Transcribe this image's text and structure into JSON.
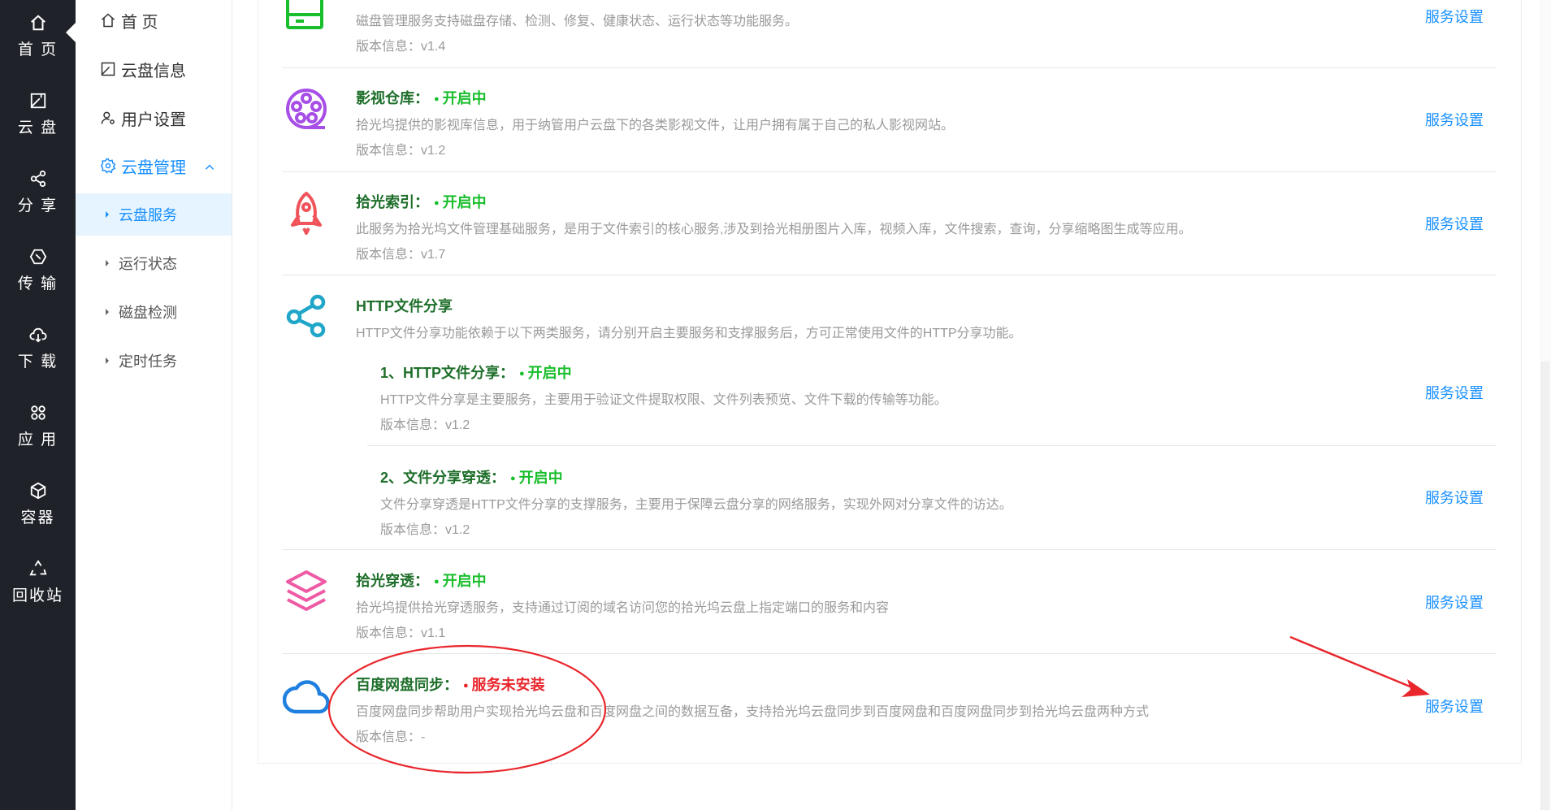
{
  "rail": {
    "items": [
      {
        "label": "首 页",
        "icon": "home-icon"
      },
      {
        "label": "云 盘",
        "icon": "disk-icon"
      },
      {
        "label": "分 享",
        "icon": "share-icon"
      },
      {
        "label": "传 输",
        "icon": "transfer-icon"
      },
      {
        "label": "下 载",
        "icon": "download-icon"
      },
      {
        "label": "应 用",
        "icon": "apps-icon"
      },
      {
        "label": "容器",
        "icon": "container-icon"
      },
      {
        "label": "回收站",
        "icon": "recycle-icon"
      }
    ]
  },
  "subnav": {
    "items": [
      {
        "label": "首 页",
        "icon": "home-icon"
      },
      {
        "label": "云盘信息",
        "icon": "disk-icon"
      },
      {
        "label": "用户设置",
        "icon": "user-settings-icon"
      },
      {
        "label": "云盘管理",
        "icon": "gear-icon"
      }
    ],
    "sub_items": [
      {
        "label": "云盘服务"
      },
      {
        "label": "运行状态"
      },
      {
        "label": "磁盘检测"
      },
      {
        "label": "定时任务"
      }
    ]
  },
  "services": [
    {
      "title": "",
      "status": "",
      "desc": "磁盘管理服务支持磁盘存储、检测、修复、健康状态、运行状态等功能服务。",
      "version": "版本信息：v1.4",
      "link": "服务设置",
      "icon": "disk-manager-icon"
    },
    {
      "title": "影视仓库：",
      "status": "开启中",
      "desc": "拾光坞提供的影视库信息，用于纳管用户云盘下的各类影视文件，让用户拥有属于自己的私人影视网站。",
      "version": "版本信息：v1.2",
      "link": "服务设置",
      "icon": "film-reel-icon"
    },
    {
      "title": "拾光索引：",
      "status": "开启中",
      "desc": "此服务为拾光坞文件管理基础服务，是用于文件索引的核心服务,涉及到拾光相册图片入库，视频入库，文件搜索，查询，分享缩略图生成等应用。",
      "version": "版本信息：v1.7",
      "link": "服务设置",
      "icon": "rocket-icon"
    },
    {
      "title": "HTTP文件分享",
      "desc": "HTTP文件分享功能依赖于以下两类服务，请分别开启主要服务和支撑服务后，方可正常使用文件的HTTP分享功能。",
      "icon": "share-nodes-icon",
      "children": [
        {
          "title": "1、HTTP文件分享：",
          "status": "开启中",
          "desc": "HTTP文件分享是主要服务，主要用于验证文件提取权限、文件列表预览、文件下载的传输等功能。",
          "version": "版本信息：v1.2",
          "link": "服务设置"
        },
        {
          "title": "2、文件分享穿透：",
          "status": "开启中",
          "desc": "文件分享穿透是HTTP文件分享的支撑服务，主要用于保障云盘分享的网络服务，实现外网对分享文件的访达。",
          "version": "版本信息：v1.2",
          "link": "服务设置"
        }
      ]
    },
    {
      "title": "拾光穿透：",
      "status": "开启中",
      "desc": "拾光坞提供拾光穿透服务，支持通过订阅的域名访问您的拾光坞云盘上指定端口的服务和内容",
      "version": "版本信息：v1.1",
      "link": "服务设置",
      "icon": "layers-icon"
    },
    {
      "title": "百度网盘同步：",
      "status": "服务未安装",
      "desc": "百度网盘同步帮助用户实现拾光坞云盘和百度网盘之间的数据互备，支持拾光坞云盘同步到百度网盘和百度网盘同步到拾光坞云盘两种方式",
      "version": "版本信息：-",
      "link": "服务设置",
      "icon": "cloud-icon"
    }
  ],
  "colors": {
    "rail_bg": "#1f2329",
    "accent": "#1890ff",
    "status_on": "#19be2c",
    "status_off": "#e8262c",
    "annotation": "#e8262c"
  }
}
